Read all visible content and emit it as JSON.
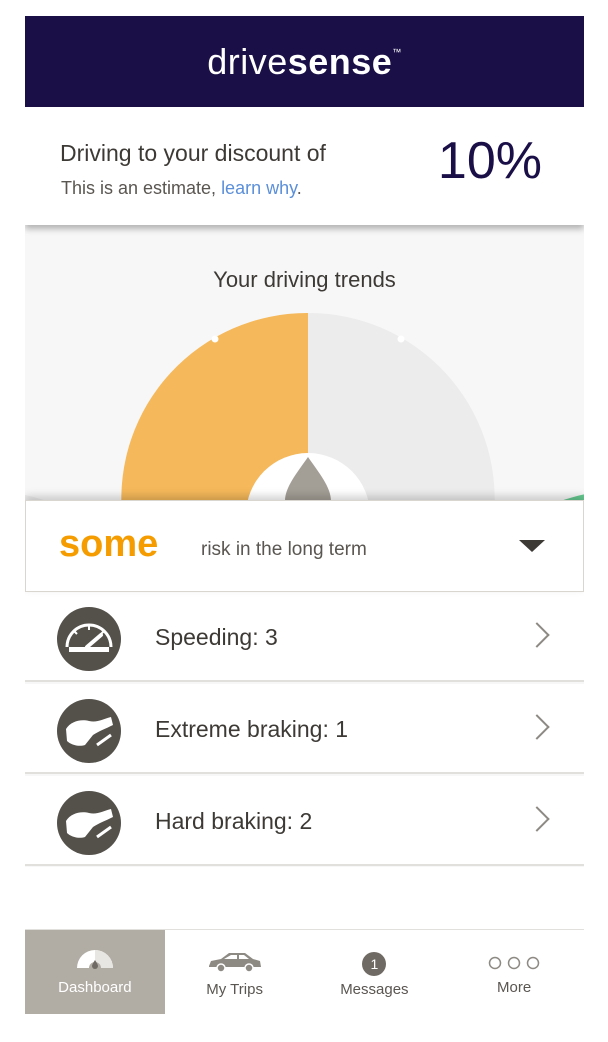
{
  "app": {
    "logo_light": "drive",
    "logo_bold": "sense",
    "logo_tm": "™"
  },
  "discount": {
    "line1": "Driving to your discount of",
    "line2_prefix": "This is an estimate, ",
    "line2_link": "learn why",
    "line2_suffix": ".",
    "value": "10%"
  },
  "trends": {
    "title": "Your driving trends",
    "gauge_colors": {
      "active": "#f5b85a",
      "inactive": "#ececec",
      "next": "#65c990"
    }
  },
  "risk": {
    "level_word": "some",
    "description": "risk in the long term",
    "level_color": "#f59d00"
  },
  "events": [
    {
      "label": "Speeding: 3",
      "icon": "speedometer-icon"
    },
    {
      "label": "Extreme braking: 1",
      "icon": "brake-shoe-icon"
    },
    {
      "label": "Hard braking: 2",
      "icon": "brake-shoe-icon"
    }
  ],
  "tabs": [
    {
      "label": "Dashboard",
      "icon": "dashboard-gauge-icon",
      "active": true
    },
    {
      "label": "My Trips",
      "icon": "car-icon",
      "active": false
    },
    {
      "label": "Messages",
      "icon": "message-badge-icon",
      "badge": "1",
      "active": false
    },
    {
      "label": "More",
      "icon": "more-dots-icon",
      "active": false
    }
  ],
  "colors": {
    "header_bg": "#1b0f47",
    "link": "#5b8fd9",
    "tab_active_bg": "#b1aca4"
  }
}
